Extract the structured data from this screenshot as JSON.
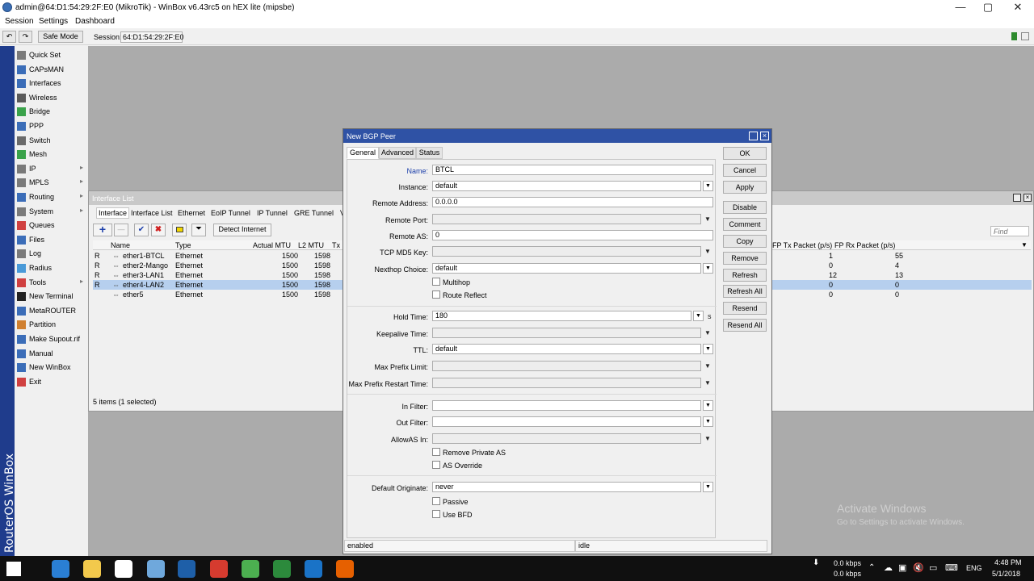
{
  "window": {
    "title": "admin@64:D1:54:29:2F:E0 (MikroTik) - WinBox v6.43rc5 on hEX lite (mipsbe)",
    "minimize": "—",
    "maximize": "▢",
    "close": "✕"
  },
  "menu": [
    "Session",
    "Settings",
    "Dashboard"
  ],
  "toolbar": {
    "undo": "↶",
    "redo": "↷",
    "safe_mode": "Safe Mode",
    "session_label": "Session:",
    "session_value": "64:D1:54:29:2F:E0"
  },
  "sidebar": {
    "brand": "RouterOS WinBox",
    "items": [
      {
        "label": "Quick Set",
        "icon": "quick-set-icon",
        "color": "#7a7a7a",
        "submenu": false
      },
      {
        "label": "CAPsMAN",
        "icon": "capsman-icon",
        "color": "#3b6db8",
        "submenu": false
      },
      {
        "label": "Interfaces",
        "icon": "interfaces-icon",
        "color": "#3b6db8",
        "submenu": false
      },
      {
        "label": "Wireless",
        "icon": "wireless-icon",
        "color": "#5a5a5a",
        "submenu": false
      },
      {
        "label": "Bridge",
        "icon": "bridge-icon",
        "color": "#3aa24a",
        "submenu": false
      },
      {
        "label": "PPP",
        "icon": "ppp-icon",
        "color": "#3b6db8",
        "submenu": false
      },
      {
        "label": "Switch",
        "icon": "switch-icon",
        "color": "#6a6a6a",
        "submenu": false
      },
      {
        "label": "Mesh",
        "icon": "mesh-icon",
        "color": "#3aa24a",
        "submenu": false
      },
      {
        "label": "IP",
        "icon": "ip-icon",
        "color": "#7a7a7a",
        "submenu": true
      },
      {
        "label": "MPLS",
        "icon": "mpls-icon",
        "color": "#7a7a7a",
        "submenu": true
      },
      {
        "label": "Routing",
        "icon": "routing-icon",
        "color": "#3b6db8",
        "submenu": true
      },
      {
        "label": "System",
        "icon": "system-icon",
        "color": "#7a7a7a",
        "submenu": true
      },
      {
        "label": "Queues",
        "icon": "queues-icon",
        "color": "#d04040",
        "submenu": false
      },
      {
        "label": "Files",
        "icon": "files-icon",
        "color": "#3b6db8",
        "submenu": false
      },
      {
        "label": "Log",
        "icon": "log-icon",
        "color": "#7a7a7a",
        "submenu": false
      },
      {
        "label": "Radius",
        "icon": "radius-icon",
        "color": "#4a9ad8",
        "submenu": false
      },
      {
        "label": "Tools",
        "icon": "tools-icon",
        "color": "#d04040",
        "submenu": true
      },
      {
        "label": "New Terminal",
        "icon": "terminal-icon",
        "color": "#222222",
        "submenu": false
      },
      {
        "label": "MetaROUTER",
        "icon": "metarouter-icon",
        "color": "#3b6db8",
        "submenu": false
      },
      {
        "label": "Partition",
        "icon": "partition-icon",
        "color": "#d08030",
        "submenu": false
      },
      {
        "label": "Make Supout.rif",
        "icon": "supout-icon",
        "color": "#3b6db8",
        "submenu": false
      },
      {
        "label": "Manual",
        "icon": "manual-icon",
        "color": "#3b6db8",
        "submenu": false
      },
      {
        "label": "New WinBox",
        "icon": "winbox-icon",
        "color": "#3b6db8",
        "submenu": false
      },
      {
        "label": "Exit",
        "icon": "exit-icon",
        "color": "#d04040",
        "submenu": false
      }
    ]
  },
  "interface_list": {
    "title": "Interface List",
    "tabs": [
      "Interface",
      "Interface List",
      "Ethernet",
      "EoIP Tunnel",
      "IP Tunnel",
      "GRE Tunnel",
      "V"
    ],
    "detect_internet": "Detect Internet",
    "find_placeholder": "Find",
    "columns": [
      "Name",
      "Type",
      "Actual MTU",
      "L2 MTU",
      "Tx",
      "FP Tx Packet (p/s)",
      "FP Rx Packet (p/s)"
    ],
    "rows": [
      {
        "flag": "R",
        "name": "ether1-BTCL",
        "type": "Ethernet",
        "mtu": "1500",
        "l2mtu": "1598",
        "fptx": "1",
        "fprx": "55",
        "selected": false
      },
      {
        "flag": "R",
        "name": "ether2-Mango",
        "type": "Ethernet",
        "mtu": "1500",
        "l2mtu": "1598",
        "fptx": "0",
        "fprx": "4",
        "selected": false
      },
      {
        "flag": "R",
        "name": "ether3-LAN1",
        "type": "Ethernet",
        "mtu": "1500",
        "l2mtu": "1598",
        "fptx": "12",
        "fprx": "13",
        "selected": false
      },
      {
        "flag": "R",
        "name": "ether4-LAN2",
        "type": "Ethernet",
        "mtu": "1500",
        "l2mtu": "1598",
        "fptx": "0",
        "fprx": "0",
        "selected": true
      },
      {
        "flag": "",
        "name": "ether5",
        "type": "Ethernet",
        "mtu": "1500",
        "l2mtu": "1598",
        "fptx": "0",
        "fprx": "0",
        "selected": false
      }
    ],
    "status": "5 items (1 selected)"
  },
  "bgp_dialog": {
    "title": "New BGP Peer",
    "tabs": [
      "General",
      "Advanced",
      "Status"
    ],
    "fields": {
      "name": {
        "label": "Name:",
        "value": "BTCL"
      },
      "instance": {
        "label": "Instance:",
        "value": "default"
      },
      "remote_address": {
        "label": "Remote Address:",
        "value": "0.0.0.0"
      },
      "remote_port": {
        "label": "Remote Port:",
        "value": ""
      },
      "remote_as": {
        "label": "Remote AS:",
        "value": "0"
      },
      "tcp_md5": {
        "label": "TCP MD5 Key:",
        "value": ""
      },
      "nexthop": {
        "label": "Nexthop Choice:",
        "value": "default"
      },
      "hold_time": {
        "label": "Hold Time:",
        "value": "180",
        "unit": "s"
      },
      "keepalive": {
        "label": "Keepalive Time:",
        "value": ""
      },
      "ttl": {
        "label": "TTL:",
        "value": "default"
      },
      "max_prefix": {
        "label": "Max Prefix Limit:",
        "value": ""
      },
      "max_prefix_restart": {
        "label": "Max Prefix Restart Time:",
        "value": ""
      },
      "in_filter": {
        "label": "In Filter:",
        "value": ""
      },
      "out_filter": {
        "label": "Out Filter:",
        "value": ""
      },
      "allowas": {
        "label": "AllowAS In:",
        "value": ""
      },
      "default_originate": {
        "label": "Default Originate:",
        "value": "never"
      }
    },
    "checkboxes": {
      "multihop": "Multihop",
      "route_reflect": "Route Reflect",
      "remove_private_as": "Remove Private AS",
      "as_override": "AS Override",
      "passive": "Passive",
      "use_bfd": "Use BFD"
    },
    "buttons": [
      "OK",
      "Cancel",
      "Apply",
      "Disable",
      "Comment",
      "Copy",
      "Remove",
      "Refresh",
      "Refresh All",
      "Resend",
      "Resend All"
    ],
    "status_left": "enabled",
    "status_right": "idle"
  },
  "watermark": {
    "line1": "Activate Windows",
    "line2": "Go to Settings to activate Windows."
  },
  "taskbar": {
    "apps": [
      {
        "name": "windows-start-icon",
        "color": "#ffffff"
      },
      {
        "name": "edge-icon",
        "color": "#2a7fd4"
      },
      {
        "name": "file-explorer-icon",
        "color": "#f2c94c"
      },
      {
        "name": "store-icon",
        "color": "#ffffff"
      },
      {
        "name": "winbox-taskbar-icon",
        "color": "#6fa8dc"
      },
      {
        "name": "imo-icon",
        "color": "#1e5fa8"
      },
      {
        "name": "app-red-icon",
        "color": "#d63b2f"
      },
      {
        "name": "chrome-icon",
        "color": "#4caf50"
      },
      {
        "name": "camtasia-icon",
        "color": "#2c8a3c"
      },
      {
        "name": "teamviewer-icon",
        "color": "#1a73c7"
      },
      {
        "name": "firefox-icon",
        "color": "#e66000"
      }
    ],
    "net_up": "0.0 kbps",
    "net_down": "0.0 kbps",
    "lang": "ENG",
    "time": "4:48 PM",
    "date": "5/1/2018"
  }
}
